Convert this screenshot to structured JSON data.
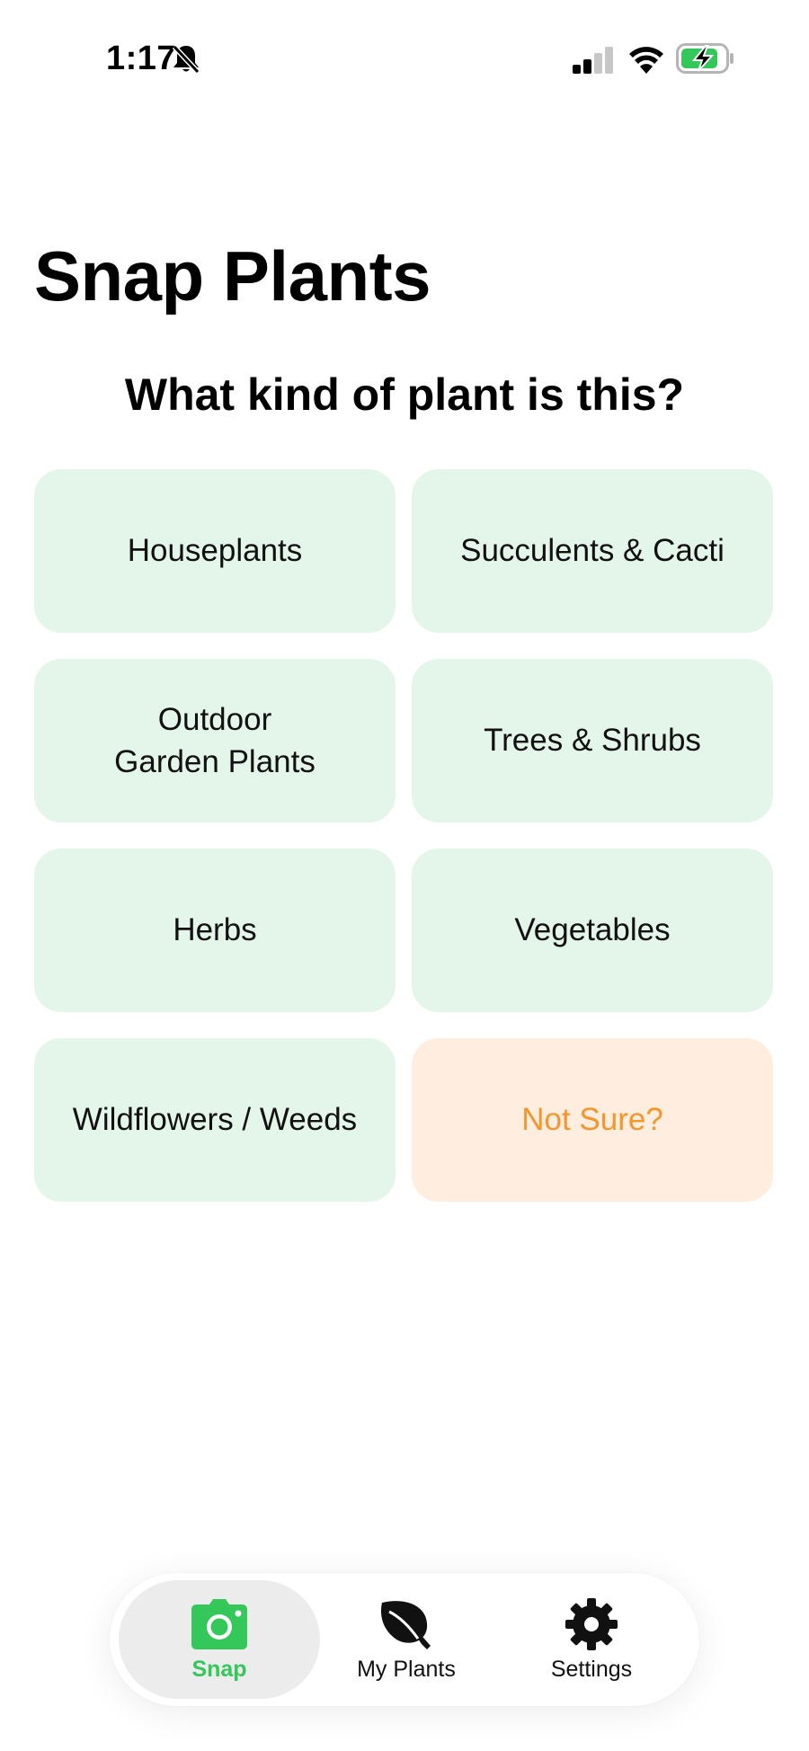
{
  "status_bar": {
    "time": "1:17",
    "icons": [
      "bell-slash-icon",
      "cellular-signal-icon",
      "wifi-icon",
      "battery-charging-icon"
    ]
  },
  "header": {
    "title": "Snap Plants",
    "question": "What kind of plant is this?"
  },
  "categories": [
    {
      "label": "Houseplants"
    },
    {
      "label": "Succulents & Cacti"
    },
    {
      "label": "Outdoor\nGarden Plants"
    },
    {
      "label": "Trees & Shrubs"
    },
    {
      "label": "Herbs"
    },
    {
      "label": "Vegetables"
    },
    {
      "label": "Wildflowers / Weeds"
    },
    {
      "label": "Not Sure?"
    }
  ],
  "tab_bar": {
    "tabs": [
      {
        "label": "Snap",
        "icon": "camera-icon",
        "active": true
      },
      {
        "label": "My Plants",
        "icon": "leaf-icon",
        "active": false
      },
      {
        "label": "Settings",
        "icon": "gear-icon",
        "active": false
      }
    ]
  },
  "colors": {
    "accent_green": "#34c759",
    "tile_green": "#e4f6ea",
    "tile_orange": "#ffede0",
    "orange_text": "#f5962d"
  }
}
